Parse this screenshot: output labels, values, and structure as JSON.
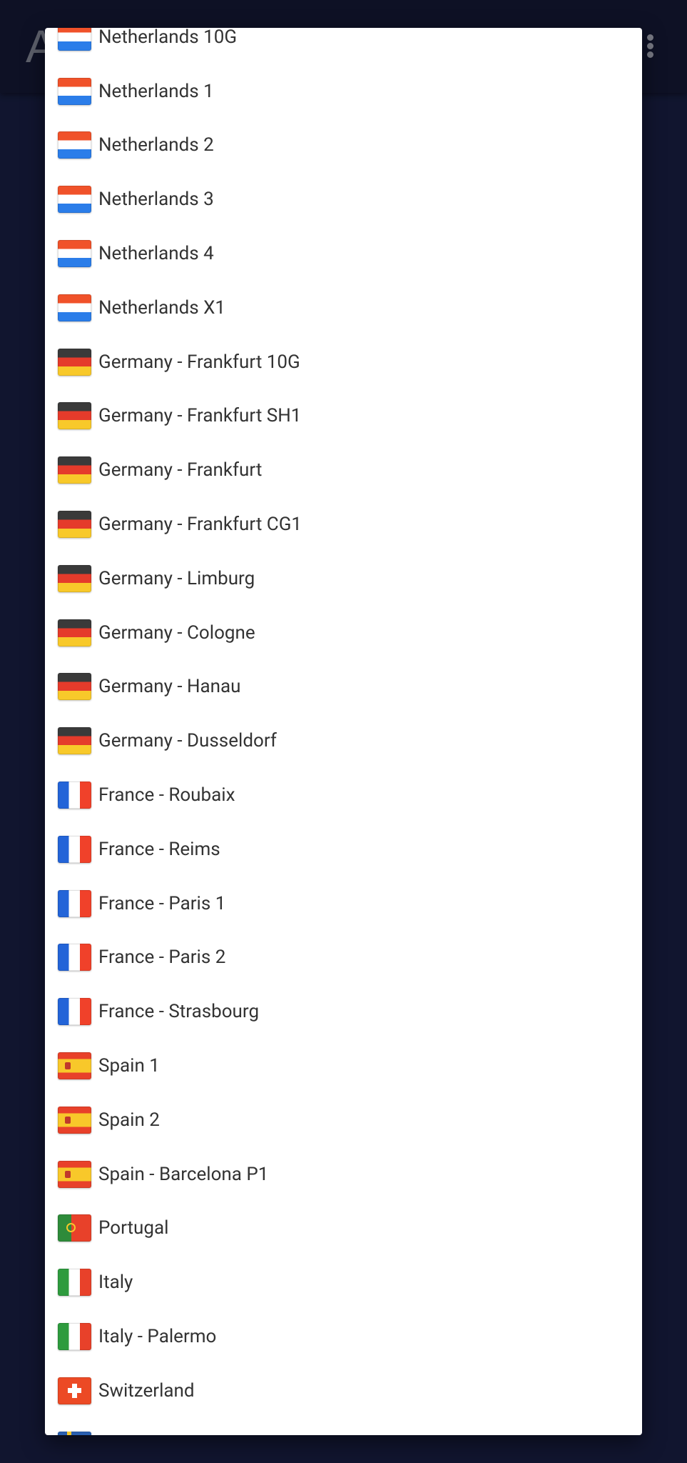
{
  "appbar": {
    "title": "A",
    "menu_icon": "more-vert-icon"
  },
  "dialog": {
    "items": [
      {
        "label": "Netherlands 10G",
        "flag": "nl"
      },
      {
        "label": "Netherlands 1",
        "flag": "nl"
      },
      {
        "label": "Netherlands 2",
        "flag": "nl"
      },
      {
        "label": "Netherlands 3",
        "flag": "nl"
      },
      {
        "label": "Netherlands 4",
        "flag": "nl"
      },
      {
        "label": "Netherlands X1",
        "flag": "nl"
      },
      {
        "label": "Germany - Frankfurt 10G",
        "flag": "de"
      },
      {
        "label": "Germany - Frankfurt SH1",
        "flag": "de"
      },
      {
        "label": "Germany - Frankfurt",
        "flag": "de"
      },
      {
        "label": "Germany - Frankfurt CG1",
        "flag": "de"
      },
      {
        "label": "Germany - Limburg",
        "flag": "de"
      },
      {
        "label": "Germany - Cologne",
        "flag": "de"
      },
      {
        "label": "Germany - Hanau",
        "flag": "de"
      },
      {
        "label": "Germany - Dusseldorf",
        "flag": "de"
      },
      {
        "label": "France - Roubaix",
        "flag": "fr"
      },
      {
        "label": "France - Reims",
        "flag": "fr"
      },
      {
        "label": "France - Paris 1",
        "flag": "fr"
      },
      {
        "label": "France - Paris 2",
        "flag": "fr"
      },
      {
        "label": "France - Strasbourg",
        "flag": "fr"
      },
      {
        "label": "Spain 1",
        "flag": "es"
      },
      {
        "label": "Spain 2",
        "flag": "es"
      },
      {
        "label": "Spain - Barcelona P1",
        "flag": "es"
      },
      {
        "label": "Portugal",
        "flag": "pt"
      },
      {
        "label": "Italy",
        "flag": "it"
      },
      {
        "label": "Italy - Palermo",
        "flag": "it"
      },
      {
        "label": "Switzerland",
        "flag": "ch"
      },
      {
        "label": "",
        "flag": "se"
      }
    ]
  }
}
